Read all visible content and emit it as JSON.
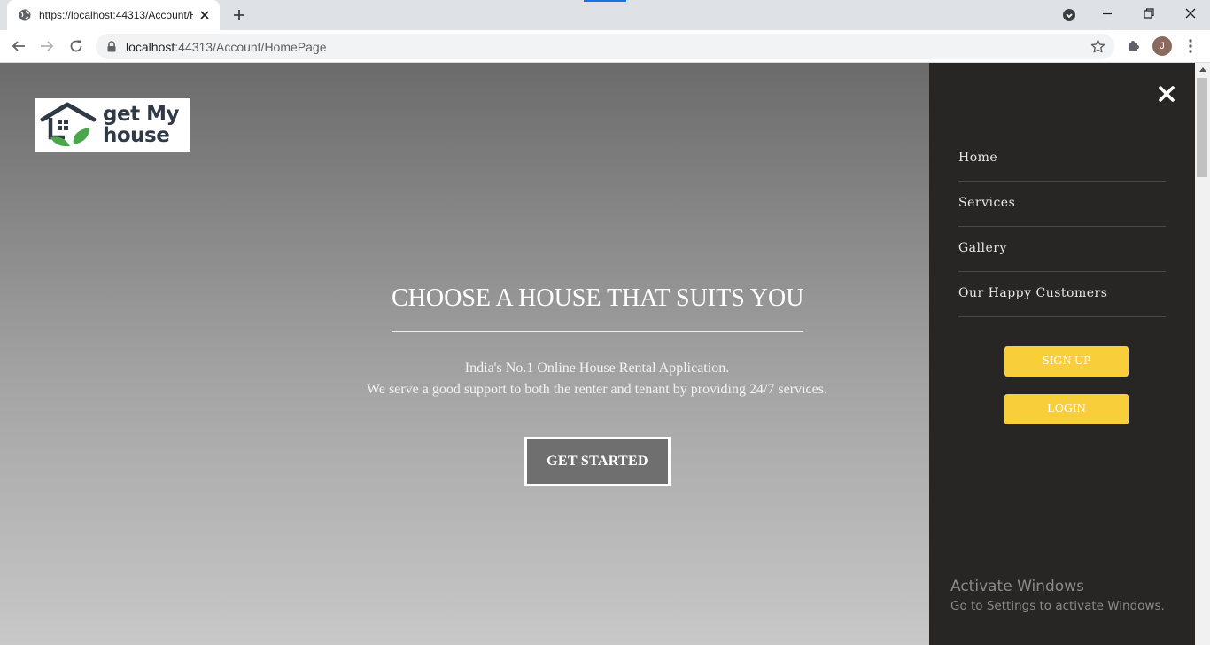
{
  "browser": {
    "tab_title": "https://localhost:44313/Account/HomePage",
    "url_host": "localhost",
    "url_rest": ":44313/Account/HomePage",
    "profile_initial": "J"
  },
  "page": {
    "logo": {
      "line1": "get My",
      "line2": "house"
    },
    "hero": {
      "headline": "CHOOSE A HOUSE THAT SUITS YOU",
      "tagline_line1": "India's No.1 Online House Rental Application.",
      "tagline_line2": "We serve a good support to both the renter and tenant by providing 24/7 services.",
      "cta_label": "GET STARTED"
    },
    "sidebar": {
      "items": [
        {
          "label": "Home"
        },
        {
          "label": "Services"
        },
        {
          "label": "Gallery"
        },
        {
          "label": "Our Happy Customers"
        }
      ],
      "signup_label": "SIGN UP",
      "login_label": "LOGIN"
    }
  },
  "os_overlay": {
    "title": "Activate Windows",
    "subtitle": "Go to Settings to activate Windows."
  },
  "colors": {
    "panel_bg": "#272624",
    "button_yellow": "#f8cf3a",
    "cta_bg": "#6f6f6f"
  }
}
